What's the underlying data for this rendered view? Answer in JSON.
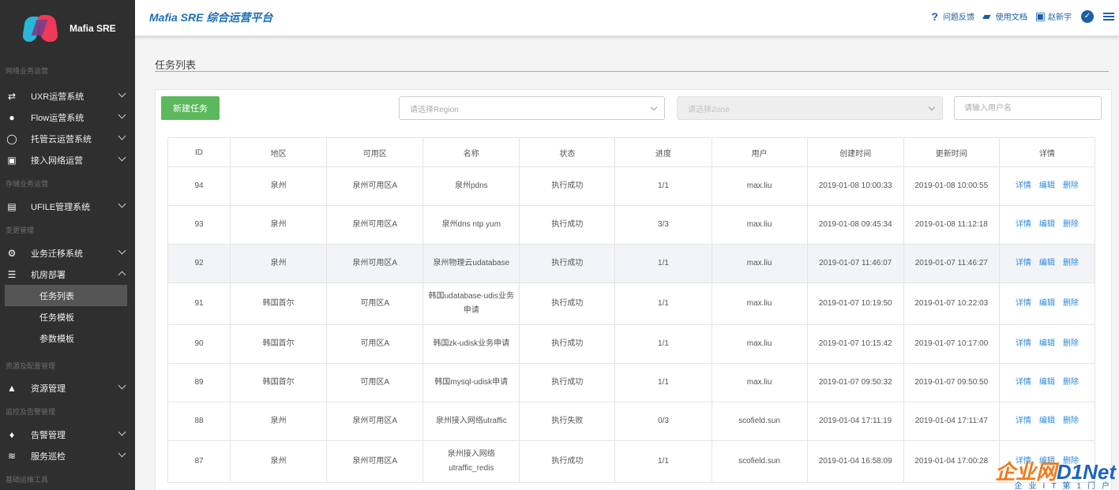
{
  "brand": {
    "name": "Mafia SRE"
  },
  "header": {
    "title": "Mafia SRE 综合运营平台",
    "feedback": "问题反馈",
    "docs": "使用文档",
    "user": "赵新宇"
  },
  "sidebar": {
    "sections": {
      "network": "网络业务运营",
      "storage": "存储业务运营",
      "change": "变更管理",
      "resource": "资源及配置管理",
      "monitor": "监控及告警管理",
      "tools": "基础运维工具"
    },
    "items": {
      "uxr": "UXR运营系统",
      "flow": "Flow运营系统",
      "hosted": "托管云运营系统",
      "access": "接入网络运营",
      "ufile": "UFILE管理系统",
      "migrate": "业务迁移系统",
      "deploy": "机房部署",
      "task_list": "任务列表",
      "task_template": "任务模板",
      "param_template": "参数模板",
      "resource_mgmt": "资源管理",
      "alarm": "告警管理",
      "inspect": "服务巡检"
    }
  },
  "main": {
    "page_title": "任务列表",
    "new_task": "新建任务",
    "region_placeholder": "请选择Region",
    "zone_placeholder": "请选择Zone",
    "user_placeholder": "请输入用户名",
    "columns": [
      "ID",
      "地区",
      "可用区",
      "名称",
      "状态",
      "进度",
      "用户",
      "创建时间",
      "更新时间",
      "详情"
    ],
    "actions": {
      "detail": "详情",
      "edit": "编辑",
      "delete": "删除"
    },
    "rows": [
      {
        "id": "94",
        "region": "泉州",
        "zone": "泉州可用区A",
        "name": "泉州pdns",
        "status": "执行成功",
        "progress": "1/1",
        "user": "max.liu",
        "created": "2019-01-08 10:00:33",
        "updated": "2019-01-08 10:00:55"
      },
      {
        "id": "93",
        "region": "泉州",
        "zone": "泉州可用区A",
        "name": "泉州dns ntp yum",
        "status": "执行成功",
        "progress": "3/3",
        "user": "max.liu",
        "created": "2019-01-08 09:45:34",
        "updated": "2019-01-08 11:12:18"
      },
      {
        "id": "92",
        "region": "泉州",
        "zone": "泉州可用区A",
        "name": "泉州物理云udatabase",
        "status": "执行成功",
        "progress": "1/1",
        "user": "max.liu",
        "created": "2019-01-07 11:46:07",
        "updated": "2019-01-07 11:46:27"
      },
      {
        "id": "91",
        "region": "韩国首尔",
        "zone": "可用区A",
        "name": "韩国udatabase-udis业务申请",
        "status": "执行成功",
        "progress": "1/1",
        "user": "max.liu",
        "created": "2019-01-07 10:19:50",
        "updated": "2019-01-07 10:22:03"
      },
      {
        "id": "90",
        "region": "韩国首尔",
        "zone": "可用区A",
        "name": "韩国zk-udisk业务申请",
        "status": "执行成功",
        "progress": "1/1",
        "user": "max.liu",
        "created": "2019-01-07 10:15:42",
        "updated": "2019-01-07 10:17:00"
      },
      {
        "id": "89",
        "region": "韩国首尔",
        "zone": "可用区A",
        "name": "韩国mysql-udisk申请",
        "status": "执行成功",
        "progress": "1/1",
        "user": "max.liu",
        "created": "2019-01-07 09:50:32",
        "updated": "2019-01-07 09:50:50"
      },
      {
        "id": "88",
        "region": "泉州",
        "zone": "泉州可用区A",
        "name": "泉州接入网络utraffic",
        "status": "执行失败",
        "progress": "0/3",
        "user": "scofield.sun",
        "created": "2019-01-04 17:11:19",
        "updated": "2019-01-04 17:11:47"
      },
      {
        "id": "87",
        "region": "泉州",
        "zone": "泉州可用区A",
        "name": "泉州接入网络utraffic_redis",
        "status": "执行成功",
        "progress": "1/1",
        "user": "scofield.sun",
        "created": "2019-01-04 16:58:09",
        "updated": "2019-01-04 17:00:28"
      }
    ]
  },
  "watermark": {
    "brand_a": "企业网",
    "brand_b": "D1Net",
    "tagline": "企业IT第1门户"
  }
}
